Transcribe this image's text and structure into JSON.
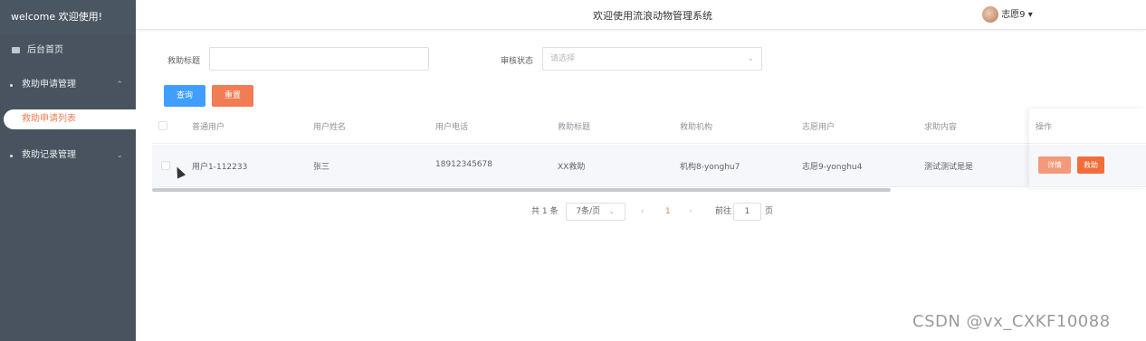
{
  "sidebar": {
    "brand": "welcome 欢迎使用!",
    "items": [
      {
        "label": "后台首页"
      },
      {
        "label": "救助申请管理",
        "arrow": "^"
      },
      {
        "label": "救助申请列表"
      },
      {
        "label": "救助记录管理",
        "arrow": "v"
      }
    ]
  },
  "header": {
    "title": "欢迎使用流浪动物管理系统",
    "user": "志愿9"
  },
  "search": {
    "title_label": "救助标题",
    "title_value": "",
    "status_label": "审核状态",
    "status_placeholder": "请选择",
    "query_button": "查询",
    "reset_button": "重置"
  },
  "table": {
    "headers": [
      "普通用户",
      "用户姓名",
      "用户电话",
      "救助标题",
      "救助机构",
      "志愿用户",
      "求助内容",
      "操作"
    ],
    "rows": [
      {
        "cells": [
          "用户1-112233",
          "张三",
          "18912345678",
          "XX救助",
          "机构8-yonghu7",
          "志愿9-yonghu4",
          "测试测试是是"
        ],
        "actions": [
          "详情",
          "救助"
        ]
      }
    ]
  },
  "pagination": {
    "total": "共 1 条",
    "page_size": "7条/页",
    "current_page": "1",
    "goto_label": "前往",
    "goto_value": "1",
    "page_suffix": "页"
  },
  "watermark": "CSDN @vx_CXKF10088",
  "colors": {
    "sidebar_bg": "#48535f",
    "primary": "#409eff",
    "accent": "#f27c53"
  }
}
